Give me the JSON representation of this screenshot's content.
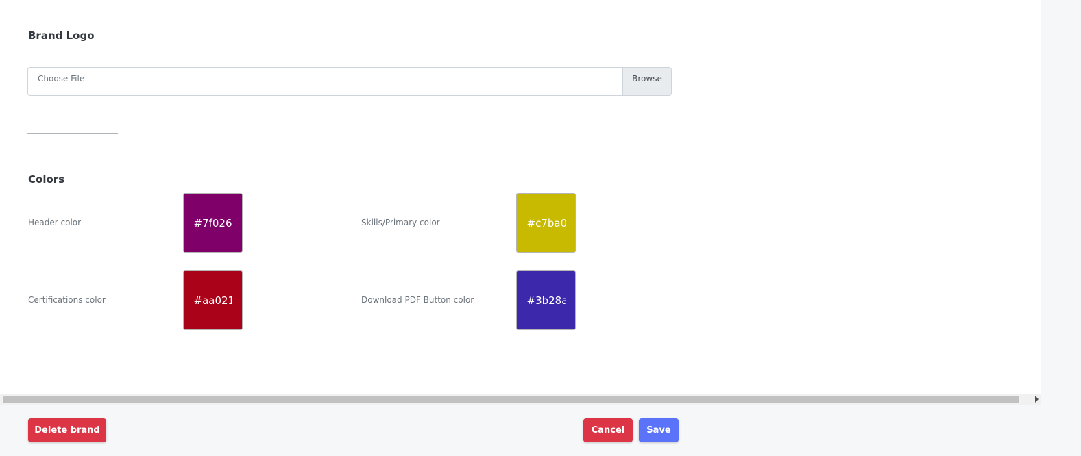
{
  "brand_logo": {
    "title": "Brand Logo",
    "file_placeholder": "Choose File",
    "browse_label": "Browse"
  },
  "colors": {
    "title": "Colors",
    "header": {
      "label": "Header color",
      "value": "#7f026",
      "color": "#7f0068"
    },
    "skills": {
      "label": "Skills/Primary color",
      "value": "#c7ba0",
      "color": "#c7ba00"
    },
    "certifications": {
      "label": "Certifications color",
      "value": "#aa021",
      "color": "#aa0218"
    },
    "download_pdf": {
      "label": "Download PDF Button color",
      "value": "#3b28a",
      "color": "#3b28aa"
    }
  },
  "footer": {
    "delete_label": "Delete brand",
    "cancel_label": "Cancel",
    "save_label": "Save"
  }
}
